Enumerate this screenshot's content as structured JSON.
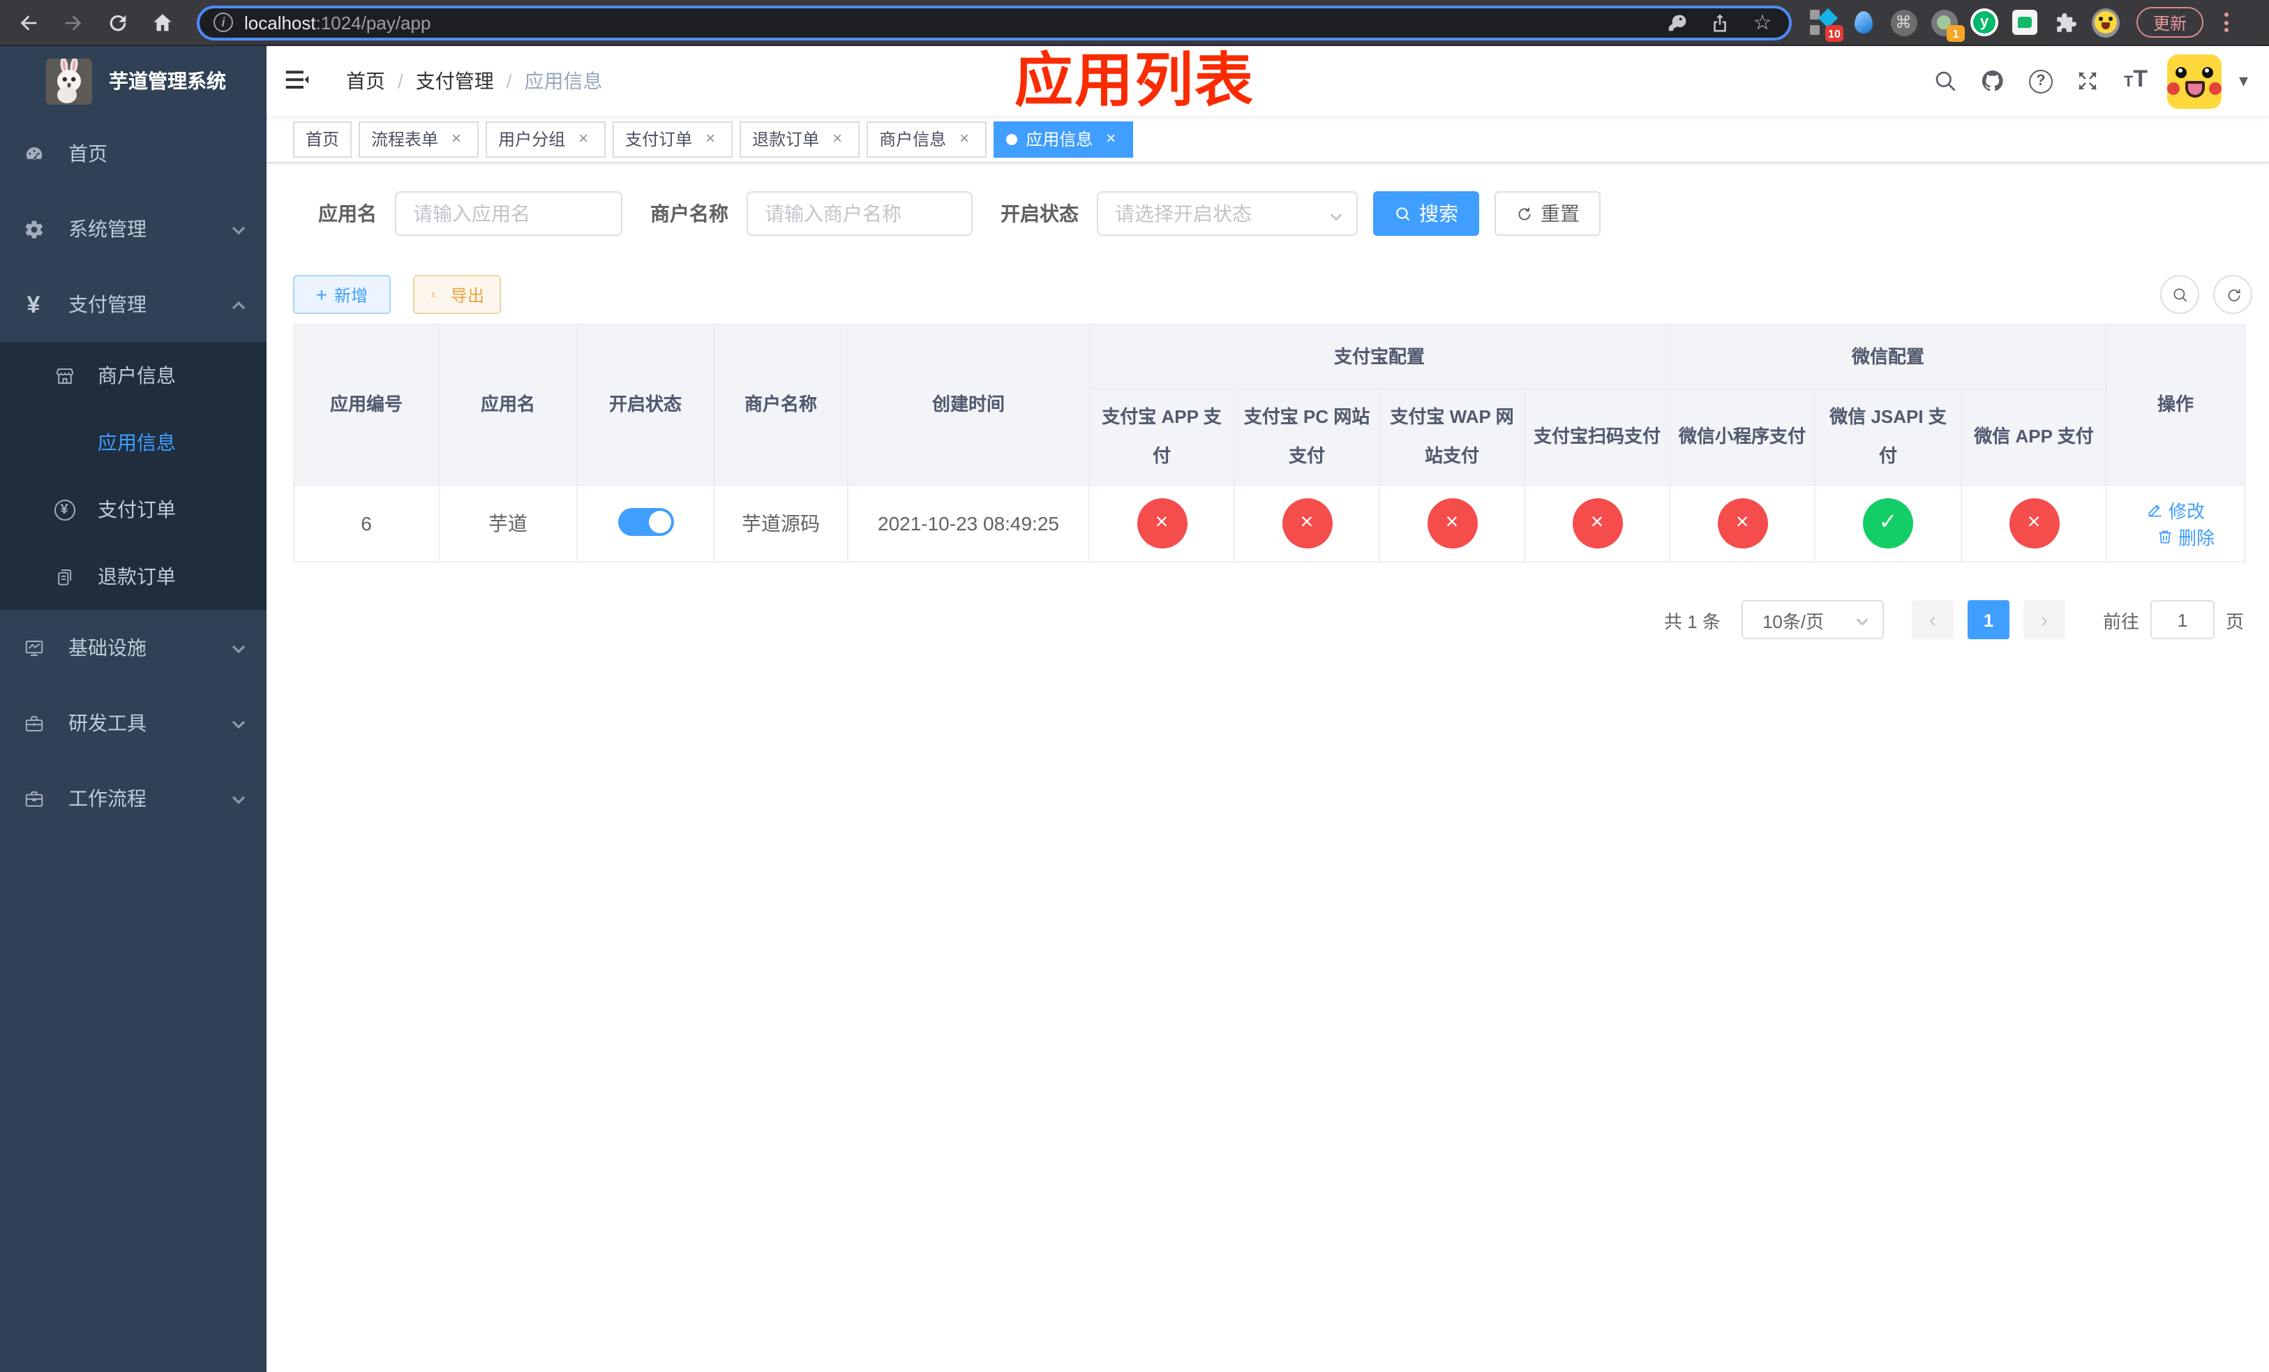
{
  "browser": {
    "url_host": "localhost",
    "url_path": ":1024/pay/app",
    "update_label": "更新",
    "extensions": {
      "tampermonkey_badge": "10",
      "recorder_badge": "1",
      "yuque_letter": "y"
    }
  },
  "icons": {
    "check": "✓",
    "cross": "×",
    "star": "☆",
    "command": "⌘",
    "prev": "‹",
    "next": "›",
    "plus": "+",
    "caret_down": "▾",
    "question": "?",
    "info": "i",
    "slash": "/",
    "text_small": "T",
    "text_big": "T"
  },
  "app": {
    "title": "芋道管理系统",
    "annotation": "应用列表"
  },
  "sidebar": {
    "items": [
      {
        "label": "首页"
      },
      {
        "label": "系统管理"
      },
      {
        "label": "支付管理"
      },
      {
        "label": "商户信息"
      },
      {
        "label": "应用信息"
      },
      {
        "label": "支付订单"
      },
      {
        "label": "退款订单"
      },
      {
        "label": "基础设施"
      },
      {
        "label": "研发工具"
      },
      {
        "label": "工作流程"
      }
    ]
  },
  "breadcrumb": {
    "items": [
      {
        "label": "首页"
      },
      {
        "label": "支付管理"
      },
      {
        "label": "应用信息"
      }
    ]
  },
  "tabs": [
    {
      "label": "首页",
      "closable": false,
      "active": false
    },
    {
      "label": "流程表单",
      "closable": true,
      "active": false
    },
    {
      "label": "用户分组",
      "closable": true,
      "active": false
    },
    {
      "label": "支付订单",
      "closable": true,
      "active": false
    },
    {
      "label": "退款订单",
      "closable": true,
      "active": false
    },
    {
      "label": "商户信息",
      "closable": true,
      "active": false
    },
    {
      "label": "应用信息",
      "closable": true,
      "active": true
    }
  ],
  "filters": {
    "app_name_label": "应用名",
    "app_name_placeholder": "请输入应用名",
    "app_name_value": "",
    "merchant_label": "商户名称",
    "merchant_placeholder": "请输入商户名称",
    "merchant_value": "",
    "status_label": "开启状态",
    "status_placeholder": "请选择开启状态",
    "search_label": "搜索",
    "reset_label": "重置"
  },
  "toolbar": {
    "add_label": "新增",
    "export_label": "导出"
  },
  "table": {
    "header": {
      "col_id": "应用编号",
      "col_name": "应用名",
      "col_status": "开启状态",
      "col_merchant": "商户名称",
      "col_created": "创建时间",
      "group_alipay": "支付宝配置",
      "group_wechat": "微信配置",
      "col_alipay_app": "支付宝 APP 支付",
      "col_alipay_pc": "支付宝 PC 网站支付",
      "col_alipay_wap": "支付宝 WAP 网站支付",
      "col_alipay_qr": "支付宝扫码支付",
      "col_wx_lite": "微信小程序支付",
      "col_wx_jsapi": "微信 JSAPI 支付",
      "col_wx_app": "微信 APP 支付",
      "col_actions": "操作"
    },
    "rows": [
      {
        "id": "6",
        "name": "芋道",
        "enabled": true,
        "merchant": "芋道源码",
        "created_at": "2021-10-23 08:49:25",
        "channels": [
          false,
          false,
          false,
          false,
          false,
          true,
          false
        ],
        "edit_label": "修改",
        "delete_label": "删除"
      }
    ]
  },
  "pagination": {
    "total_label": "共 1 条",
    "page_size": "10条/页",
    "current_page": "1",
    "goto_label": "前往",
    "goto_value": "1",
    "unit_label": "页"
  },
  "colors": {
    "accent": "#409eff",
    "success": "#13ce66",
    "danger": "#f54c4c",
    "warning": "#e6a23c",
    "sidebar_bg": "#304156",
    "submenu_bg": "#1f2d3d",
    "annotation_red": "#fb2b01"
  }
}
